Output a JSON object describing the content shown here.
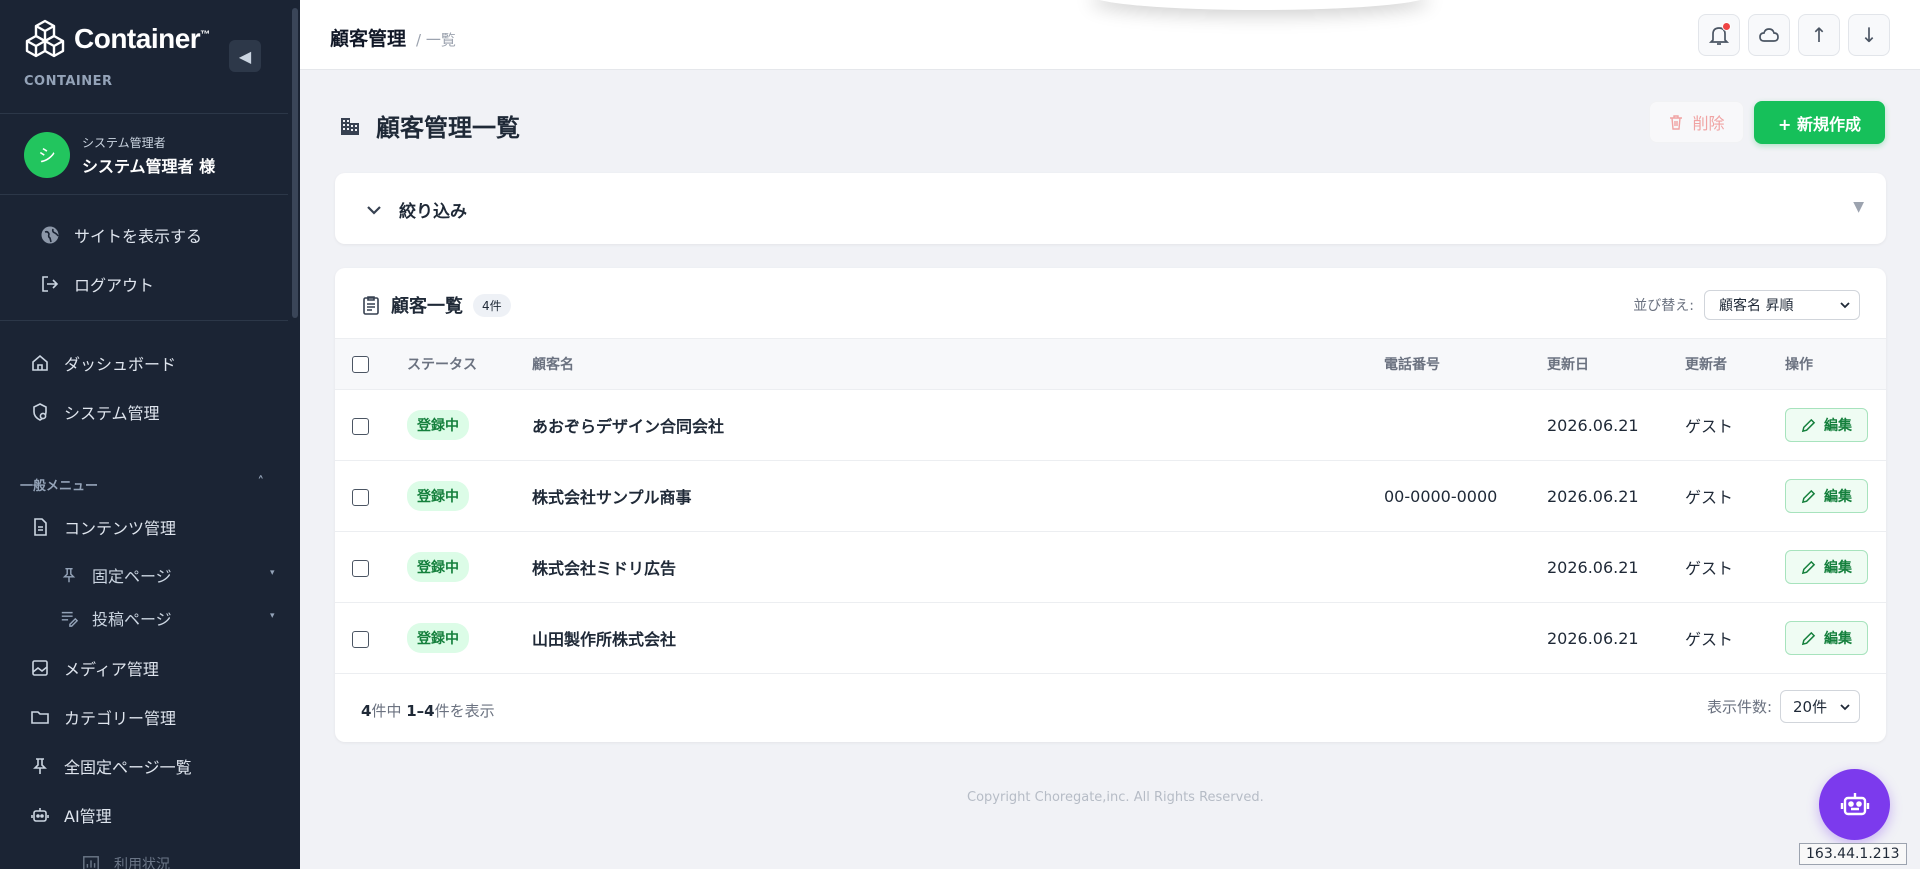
{
  "sidebar": {
    "brand": "Container",
    "brand_tm": "™",
    "brand_sub": "CONTAINER",
    "user": {
      "avatar": "シ",
      "role": "システム管理者",
      "name": "システム管理者 様"
    },
    "links": [
      {
        "label": "サイトを表示する",
        "icon": "globe-icon"
      },
      {
        "label": "ログアウト",
        "icon": "logout-icon"
      }
    ],
    "nav": [
      {
        "label": "ダッシュボード",
        "icon": "home-icon"
      },
      {
        "label": "システム管理",
        "icon": "shield-gear-icon"
      }
    ],
    "section_label": "一般メニュー",
    "section_caret": "˄",
    "menu": [
      {
        "label": "コンテンツ管理",
        "icon": "document-icon"
      },
      {
        "label": "固定ページ",
        "icon": "pin-icon",
        "caret": "▾"
      },
      {
        "label": "投稿ページ",
        "icon": "list-edit-icon",
        "caret": "▾"
      },
      {
        "label": "メディア管理",
        "icon": "image-icon"
      },
      {
        "label": "カテゴリー管理",
        "icon": "folder-icon"
      },
      {
        "label": "全固定ページ一覧",
        "icon": "pin-icon"
      },
      {
        "label": "AI管理",
        "icon": "robot-icon"
      },
      {
        "label": "利用状況",
        "icon": "chart-icon"
      }
    ],
    "collapse_icon": "◀"
  },
  "topbar": {
    "title": "顧客管理",
    "crumb": "/ 一覧",
    "buttons": [
      "bell-icon",
      "cloud-icon",
      "arrow-up-icon",
      "arrow-down-icon"
    ],
    "arrow_up": "↑",
    "arrow_down": "↓"
  },
  "page": {
    "title": "顧客管理一覧",
    "delete_label": "削除",
    "new_label": "+ 新規作成"
  },
  "filter": {
    "label": "絞り込み",
    "arrow": "▼"
  },
  "list": {
    "title": "顧客一覧",
    "count": "4件",
    "sort_label": "並び替え:",
    "sort_value": "顧客名 昇順",
    "columns": [
      "ステータス",
      "顧客名",
      "電話番号",
      "更新日",
      "更新者",
      "操作"
    ],
    "rows": [
      {
        "status": "登録中",
        "name": "あおぞらデザイン合同会社",
        "phone": "",
        "date": "2026.06.21",
        "user": "ゲスト",
        "action": "編集"
      },
      {
        "status": "登録中",
        "name": "株式会社サンプル商事",
        "phone": "00-0000-0000",
        "date": "2026.06.21",
        "user": "ゲスト",
        "action": "編集"
      },
      {
        "status": "登録中",
        "name": "株式会社ミドリ広告",
        "phone": "",
        "date": "2026.06.21",
        "user": "ゲスト",
        "action": "編集"
      },
      {
        "status": "登録中",
        "name": "山田製作所株式会社",
        "phone": "",
        "date": "2026.06.21",
        "user": "ゲスト",
        "action": "編集"
      }
    ],
    "footer": {
      "total": "4",
      "mid": "件中 ",
      "range": "1–4",
      "suffix": "件を表示"
    },
    "perpage_label": "表示件数:",
    "perpage_value": "20件"
  },
  "footer": {
    "copyright": "Copyright Choregate,inc. All Rights Reserved."
  },
  "ip": "163.44.1.213",
  "colors": {
    "sidebar_bg": "#1b2434",
    "accent_green": "#16c05a",
    "robot": "#7c3aed"
  }
}
